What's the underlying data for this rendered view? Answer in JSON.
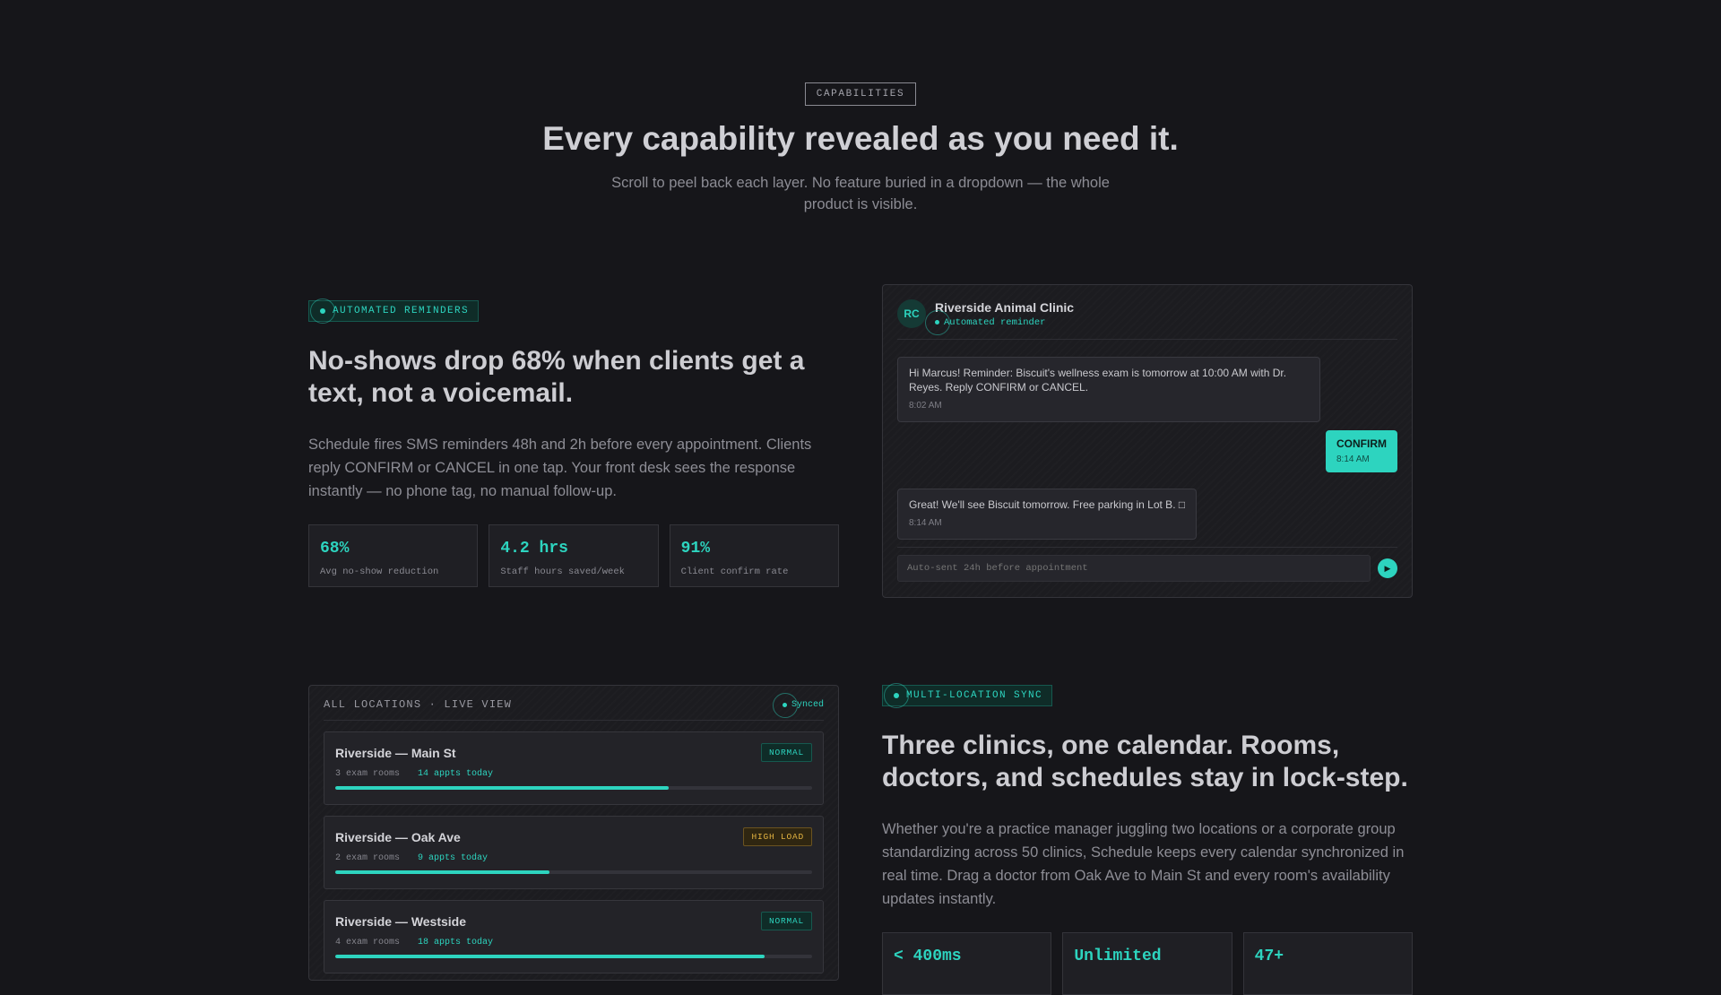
{
  "hero": {
    "pill": "CAPABILITIES",
    "title": "Every capability revealed as you need it.",
    "subtitle": "Scroll to peel back each layer. No feature buried in a dropdown — the whole product is visible."
  },
  "reminders": {
    "tag": "AUTOMATED REMINDERS",
    "title": "No-shows drop 68% when clients get a text, not a voicemail.",
    "body": "Schedule fires SMS reminders 48h and 2h before every appointment. Clients reply CONFIRM or CANCEL in one tap. Your front desk sees the response instantly — no phone tag, no manual follow-up.",
    "stats": [
      {
        "value": "68%",
        "label": "Avg no-show reduction"
      },
      {
        "value": "4.2 hrs",
        "label": "Staff hours saved/week"
      },
      {
        "value": "91%",
        "label": "Client confirm rate"
      }
    ]
  },
  "chat": {
    "avatar": "RC",
    "clinic": "Riverside Animal Clinic",
    "subtitle": "Automated reminder",
    "messages": [
      {
        "text": "Hi Marcus! Reminder: Biscuit's wellness exam is tomorrow at 10:00 AM with Dr. Reyes. Reply CONFIRM or CANCEL.",
        "time": "8:02 AM"
      },
      {
        "text": "CONFIRM",
        "time": "8:14 AM"
      },
      {
        "text": "Great! We'll see Biscuit tomorrow. Free parking in Lot B. □",
        "time": "8:14 AM"
      }
    ],
    "input_placeholder": "Auto-sent 24h before appointment",
    "send_icon": "▶"
  },
  "locations": {
    "title": "ALL LOCATIONS · LIVE VIEW",
    "status": "Synced",
    "items": [
      {
        "name": "Riverside — Main St",
        "badge": "NORMAL",
        "rooms": "3 exam rooms",
        "appts": "14 appts today",
        "load": 0.7
      },
      {
        "name": "Riverside — Oak Ave",
        "badge": "HIGH LOAD",
        "rooms": "2 exam rooms",
        "appts": "9 appts today",
        "load": 0.45
      },
      {
        "name": "Riverside — Westside",
        "badge": "NORMAL",
        "rooms": "4 exam rooms",
        "appts": "18 appts today",
        "load": 0.9
      }
    ]
  },
  "sync": {
    "tag": "MULTI-LOCATION SYNC",
    "title": "Three clinics, one calendar. Rooms, doctors, and schedules stay in lock-step.",
    "body": "Whether you're a practice manager juggling two locations or a corporate group standardizing across 50 clinics, Schedule keeps every calendar synchronized in real time. Drag a doctor from Oak Ave to Main St and every room's availability updates instantly.",
    "stats": [
      {
        "value": "< 400ms"
      },
      {
        "value": "Unlimited"
      },
      {
        "value": "47+"
      }
    ]
  },
  "colors": {
    "accent": "#2dd4bf",
    "warning": "#e3b341",
    "background": "#16161a"
  }
}
